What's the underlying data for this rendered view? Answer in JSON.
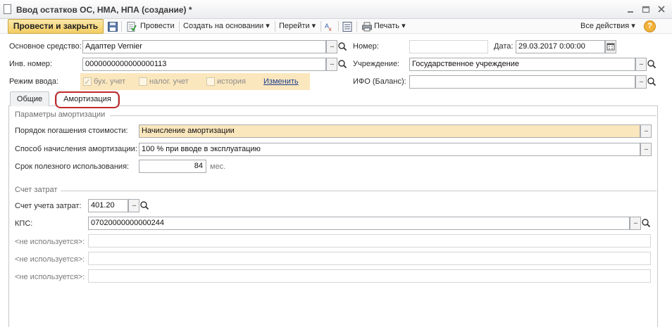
{
  "window": {
    "title": "Ввод остатков ОС, НМА, НПА (создание) *",
    "icons": {
      "minimize": "minimize-icon",
      "restore": "restore-icon",
      "close": "close-icon"
    }
  },
  "toolbar": {
    "post_close_label": "Провести и закрыть",
    "post_label": "Провести",
    "create_based_label": "Создать на основании",
    "goto_label": "Перейти",
    "print_label": "Печать",
    "all_actions_label": "Все действия",
    "help_label": "?",
    "dropdown_glyph": "▾"
  },
  "header": {
    "asset_label": "Основное средство:",
    "asset_value": "Адаптер Vernier",
    "inv_label": "Инв. номер:",
    "inv_value": "0000000000000000113",
    "mode_label": "Режим ввода:",
    "mode_options": [
      {
        "label": "бух. учет",
        "checked": true
      },
      {
        "label": "налог. учет",
        "checked": false
      },
      {
        "label": "история",
        "checked": false
      }
    ],
    "change_link": "Изменить",
    "number_label": "Номер:",
    "number_value": "",
    "date_label": "Дата:",
    "date_value": "29.03.2017  0:00:00",
    "org_label": "Учреждение:",
    "org_value": "Государственное учреждение",
    "ifo_label": "ИФО (Баланс):",
    "ifo_value": ""
  },
  "tabs": [
    {
      "label": "Общие",
      "active": false
    },
    {
      "label": "Амортизация",
      "active": true
    }
  ],
  "amortization": {
    "group_title": "Параметры амортизации",
    "repay_label": "Порядок погашения стоимости:",
    "repay_value": "Начисление амортизации",
    "method_label": "Способ начисления амортизации:",
    "method_value": "100 % при вводе в эксплуатацию",
    "life_label": "Срок полезного использования:",
    "life_value": "84",
    "life_unit": "мес."
  },
  "costs": {
    "group_title": "Счет затрат",
    "account_label": "Счет учета затрат:",
    "account_value": "401.20",
    "kps_label": "КПС:",
    "kps_value": "07020000000000244",
    "unused_label": "<не используется>:"
  },
  "colors": {
    "accent": "#f2cd62",
    "highlight": "#fbe7bd",
    "circle": "#c12a2a"
  }
}
